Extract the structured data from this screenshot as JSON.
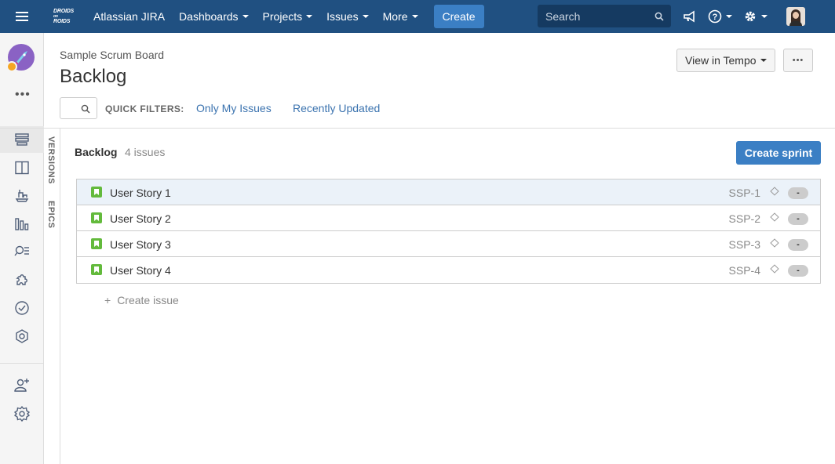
{
  "topbar": {
    "app_name": "Atlassian JIRA",
    "logo_line1": "DROIDS",
    "logo_line2": "on",
    "logo_line3": "ROIDS",
    "nav": [
      "Dashboards",
      "Projects",
      "Issues",
      "More"
    ],
    "create_label": "Create",
    "search_placeholder": "Search",
    "colors": {
      "bar": "#205081",
      "create": "#3b7fc4"
    }
  },
  "sidebar": {
    "more_dots": "•••",
    "icons": [
      "backlog-icon",
      "board-icon",
      "releases-icon",
      "reports-icon",
      "issues-search-icon",
      "components-icon",
      "tempo-icon",
      "addons-icon",
      "add-people-icon",
      "settings-icon"
    ]
  },
  "vtabs": [
    "VERSIONS",
    "EPICS"
  ],
  "header": {
    "breadcrumb": "Sample Scrum Board",
    "title": "Backlog",
    "view_tempo_label": "View in Tempo",
    "more_label": "•••"
  },
  "filters": {
    "label": "QUICK FILTERS:",
    "items": [
      "Only My Issues",
      "Recently Updated"
    ]
  },
  "backlog": {
    "heading": "Backlog",
    "count": "4 issues",
    "create_sprint_label": "Create sprint",
    "issues": [
      {
        "summary": "User Story 1",
        "key": "SSP-1",
        "estimate": "-"
      },
      {
        "summary": "User Story 2",
        "key": "SSP-2",
        "estimate": "-"
      },
      {
        "summary": "User Story 3",
        "key": "SSP-3",
        "estimate": "-"
      },
      {
        "summary": "User Story 4",
        "key": "SSP-4",
        "estimate": "-"
      }
    ],
    "create_issue_plus": "+",
    "create_issue_label": "Create issue"
  }
}
